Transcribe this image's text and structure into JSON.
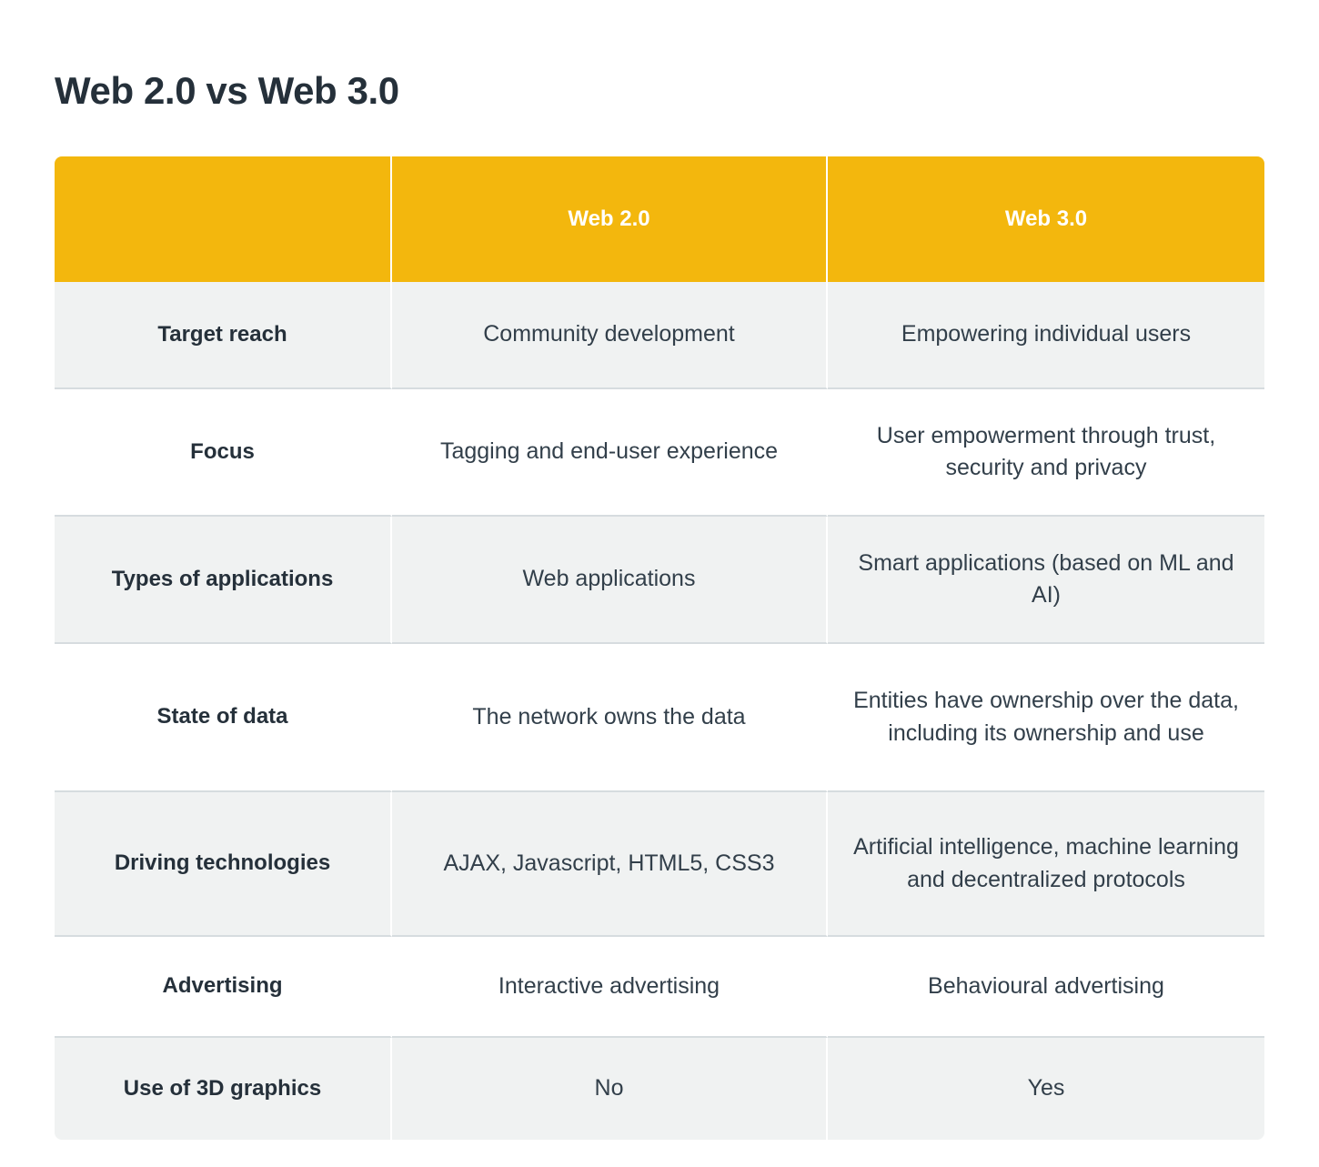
{
  "page": {
    "title": "Web 2.0 vs Web 3.0",
    "background_color": "#ffffff"
  },
  "colors": {
    "header_background": "#f3b70d",
    "header_text": "#ffffff",
    "stripe_background": "#f0f2f2",
    "plain_background": "#ffffff",
    "row_divider": "#d6dcdf",
    "body_text": "#323f4a",
    "label_text": "#25303a"
  },
  "table": {
    "columns": [
      {
        "key": "criteria",
        "label": ""
      },
      {
        "key": "web20",
        "label": "Web 2.0"
      },
      {
        "key": "web30",
        "label": "Web 3.0"
      }
    ],
    "rows": [
      {
        "label": "Target reach",
        "web20": "Community development",
        "web30": "Empowering individual users"
      },
      {
        "label": "Focus",
        "web20": "Tagging and end-user experience",
        "web30": "User empowerment through trust, security and privacy"
      },
      {
        "label": "Types of applications",
        "web20": "Web applications",
        "web30": "Smart applications (based on  ML and AI)"
      },
      {
        "label": "State of data",
        "web20": "The network owns the data",
        "web30": "Entities have ownership over the data, including its ownership and use"
      },
      {
        "label": "Driving technologies",
        "web20": "AJAX, Javascript, HTML5, CSS3",
        "web30": "Artificial intelligence, machine learning and decentralized protocols"
      },
      {
        "label": "Advertising",
        "web20": "Interactive advertising",
        "web30": "Behavioural advertising"
      },
      {
        "label": "Use of 3D graphics",
        "web20": "No",
        "web30": "Yes"
      }
    ]
  }
}
